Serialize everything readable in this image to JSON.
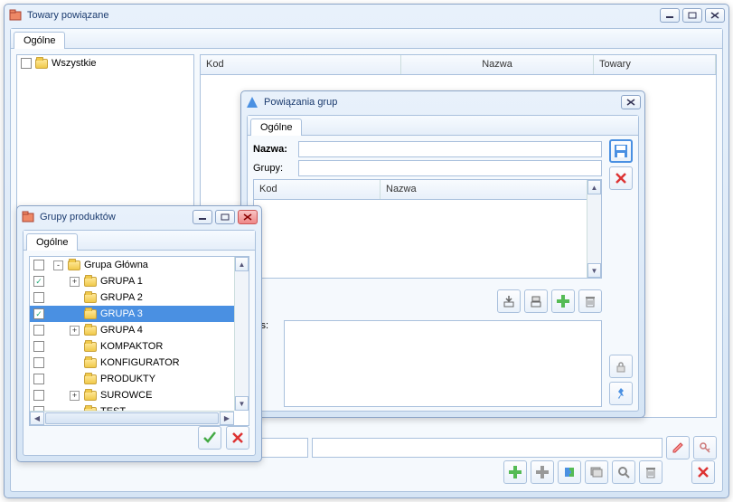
{
  "main_window": {
    "title": "Towary powiązane",
    "tab": "Ogólne",
    "tree_root": "Wszystkie",
    "grid_cols": {
      "kod": "Kod",
      "nazwa": "Nazwa",
      "towary": "Towary"
    }
  },
  "dialog_groups": {
    "title": "Powiązania grup",
    "tab": "Ogólne",
    "labels": {
      "nazwa": "Nazwa:",
      "grupy": "Grupy:",
      "opis": "pis:"
    },
    "subgrid_cols": {
      "kod": "Kod",
      "nazwa": "Nazwa"
    }
  },
  "dialog_tree": {
    "title": "Grupy produktów",
    "tab": "Ogólne",
    "items": [
      {
        "label": "Grupa Główna",
        "depth": 0,
        "exp": "-",
        "checked": false
      },
      {
        "label": "GRUPA 1",
        "depth": 1,
        "exp": "+",
        "checked": true
      },
      {
        "label": "GRUPA 2",
        "depth": 1,
        "exp": "",
        "checked": false
      },
      {
        "label": "GRUPA 3",
        "depth": 1,
        "exp": "",
        "checked": true,
        "selected": true
      },
      {
        "label": "GRUPA 4",
        "depth": 1,
        "exp": "+",
        "checked": false
      },
      {
        "label": "KOMPAKTOR",
        "depth": 1,
        "exp": "",
        "checked": false
      },
      {
        "label": "KONFIGURATOR",
        "depth": 1,
        "exp": "",
        "checked": false
      },
      {
        "label": "PRODUKTY",
        "depth": 1,
        "exp": "",
        "checked": false
      },
      {
        "label": "SUROWCE",
        "depth": 1,
        "exp": "+",
        "checked": false
      },
      {
        "label": "TEST",
        "depth": 1,
        "exp": "",
        "checked": false
      }
    ]
  }
}
